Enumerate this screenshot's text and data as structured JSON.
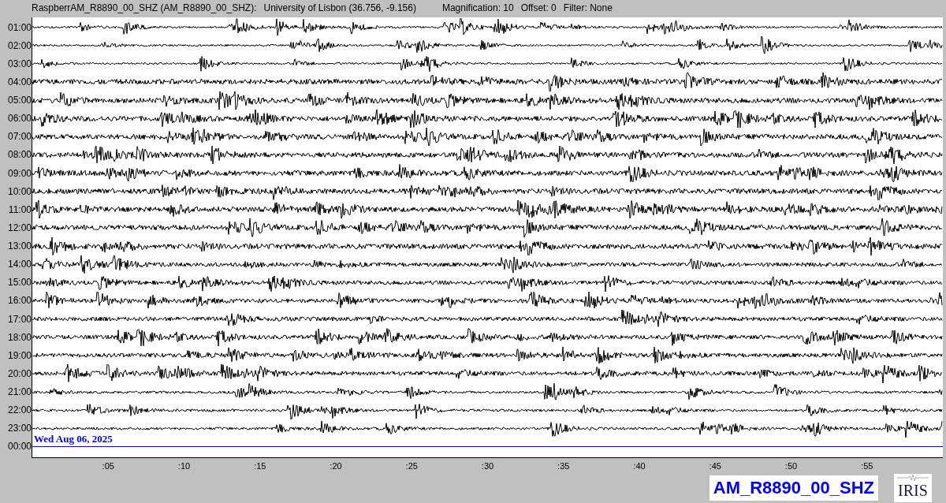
{
  "header": {
    "station": "RaspberrAM_R8890_00_SHZ (AM_R8890_00_SHZ):",
    "location": "University of Lisbon (36.756, -9.156)",
    "magnification": "Magnification: 10",
    "offset": "Offset: 0",
    "filter": "Filter: None"
  },
  "plot": {
    "rows": [
      {
        "time": "01:00",
        "kind": "trace"
      },
      {
        "time": "02:00",
        "kind": "trace"
      },
      {
        "time": "03:00",
        "kind": "trace"
      },
      {
        "time": "04:00",
        "kind": "trace"
      },
      {
        "time": "05:00",
        "kind": "trace"
      },
      {
        "time": "06:00",
        "kind": "trace"
      },
      {
        "time": "07:00",
        "kind": "trace"
      },
      {
        "time": "08:00",
        "kind": "trace"
      },
      {
        "time": "09:00",
        "kind": "trace"
      },
      {
        "time": "10:00",
        "kind": "trace"
      },
      {
        "time": "11:00",
        "kind": "trace"
      },
      {
        "time": "12:00",
        "kind": "trace"
      },
      {
        "time": "13:00",
        "kind": "trace"
      },
      {
        "time": "14:00",
        "kind": "trace"
      },
      {
        "time": "15:00",
        "kind": "trace"
      },
      {
        "time": "16:00",
        "kind": "trace"
      },
      {
        "time": "17:00",
        "kind": "trace"
      },
      {
        "time": "18:00",
        "kind": "trace"
      },
      {
        "time": "19:00",
        "kind": "trace"
      },
      {
        "time": "20:00",
        "kind": "trace"
      },
      {
        "time": "21:00",
        "kind": "trace"
      },
      {
        "time": "22:00",
        "kind": "trace"
      },
      {
        "time": "23:00",
        "kind": "trace"
      },
      {
        "time": "00:00",
        "kind": "day_marker",
        "label": "Wed Aug 06, 2025"
      }
    ],
    "x_ticks": [
      ":05",
      ":10",
      ":15",
      ":20",
      ":25",
      ":30",
      ":35",
      ":40",
      ":45",
      ":50",
      ":55"
    ]
  },
  "channel_label": "AM_R8890_00_SHZ",
  "logo": {
    "text": "IRIS"
  }
}
